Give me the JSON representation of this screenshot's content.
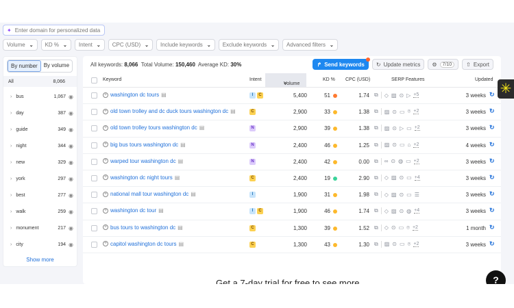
{
  "domain_input": {
    "placeholder": "Enter domain for personalized data"
  },
  "filters": [
    "Volume",
    "KD %",
    "Intent",
    "CPC (USD)",
    "Include keywords",
    "Exclude keywords",
    "Advanced filters"
  ],
  "sidebar": {
    "toggle": [
      "By number",
      "By volume"
    ],
    "all_label": "All",
    "all_count": "8,066",
    "items": [
      {
        "label": "bus",
        "count": "1,067"
      },
      {
        "label": "day",
        "count": "387"
      },
      {
        "label": "guide",
        "count": "349"
      },
      {
        "label": "night",
        "count": "344"
      },
      {
        "label": "new",
        "count": "329"
      },
      {
        "label": "york",
        "count": "297"
      },
      {
        "label": "best",
        "count": "277"
      },
      {
        "label": "walk",
        "count": "259"
      },
      {
        "label": "monument",
        "count": "217"
      },
      {
        "label": "city",
        "count": "194"
      }
    ],
    "show_more": "Show more"
  },
  "summary": {
    "all_label": "All keywords:",
    "all_value": "8,066",
    "vol_label": "Total Volume:",
    "vol_value": "150,460",
    "kd_label": "Average KD:",
    "kd_value": "30%"
  },
  "toolbar": {
    "send": "Send keywords",
    "update": "Update metrics",
    "settings_count": "7/10",
    "export": "Export"
  },
  "columns": {
    "keyword": "Keyword",
    "intent": "Intent",
    "volume": "Volume",
    "kd": "KD %",
    "cpc": "CPC (USD)",
    "serp": "SERP Features",
    "updated": "Updated"
  },
  "colors": {
    "kd_hard": "#ff7a30",
    "kd_possible": "#fdb92c",
    "kd_easy": "#3ad39a",
    "accent": "#1e88f0"
  },
  "rows": [
    {
      "keyword": "washington dc tours",
      "intent": [
        "I",
        "C"
      ],
      "volume": "5,400",
      "kd": "51",
      "kd_color": "#ff7a30",
      "cpc": "1.74",
      "serp": [
        "diamond",
        "image",
        "target",
        "play"
      ],
      "more": "+5",
      "updated": "3 weeks"
    },
    {
      "keyword": "old town trolley and dc duck tours washington dc",
      "intent": [
        "C"
      ],
      "volume": "2,900",
      "kd": "33",
      "kd_color": "#fdb92c",
      "cpc": "1.38",
      "serp": [
        "image",
        "target",
        "comment",
        "pin"
      ],
      "more": "+2",
      "updated": "3 weeks"
    },
    {
      "keyword": "old town trolley tours washington dc",
      "intent": [
        "N"
      ],
      "volume": "2,900",
      "kd": "39",
      "kd_color": "#fdb92c",
      "cpc": "1.38",
      "serp": [
        "image",
        "target",
        "play",
        "comment"
      ],
      "more": "+2",
      "updated": "3 weeks"
    },
    {
      "keyword": "big bus tours washington dc",
      "intent": [
        "N"
      ],
      "volume": "2,400",
      "kd": "46",
      "kd_color": "#fdb92c",
      "cpc": "1.25",
      "serp": [
        "image",
        "target",
        "comment",
        "cap"
      ],
      "more": "+2",
      "updated": "4 weeks"
    },
    {
      "keyword": "warped tour washington dc",
      "intent": [
        "N"
      ],
      "volume": "2,400",
      "kd": "42",
      "kd_color": "#fdb92c",
      "cpc": "0.00",
      "serp": [
        "link",
        "target",
        "globe",
        "comment"
      ],
      "more": "+2",
      "updated": "3 weeks"
    },
    {
      "keyword": "washington dc night tours",
      "intent": [
        "C"
      ],
      "volume": "2,400",
      "kd": "19",
      "kd_color": "#3ad39a",
      "cpc": "2.90",
      "serp": [
        "diamond",
        "image",
        "target",
        "comment"
      ],
      "more": "+4",
      "updated": "3 weeks"
    },
    {
      "keyword": "national mall tour washington dc",
      "intent": [
        "I"
      ],
      "volume": "1,900",
      "kd": "31",
      "kd_color": "#fdb92c",
      "cpc": "1.98",
      "serp": [
        "diamond",
        "image",
        "target",
        "comment",
        "list"
      ],
      "more": "",
      "updated": "3 weeks"
    },
    {
      "keyword": "washington dc tour",
      "intent": [
        "I",
        "C"
      ],
      "volume": "1,900",
      "kd": "46",
      "kd_color": "#fdb92c",
      "cpc": "1.74",
      "serp": [
        "diamond",
        "image",
        "target",
        "globe"
      ],
      "more": "+4",
      "updated": "3 weeks"
    },
    {
      "keyword": "bus tours to washington dc",
      "intent": [
        "C"
      ],
      "volume": "1,300",
      "kd": "39",
      "kd_color": "#fdb92c",
      "cpc": "1.52",
      "serp": [
        "diamond",
        "target",
        "comment",
        "pin"
      ],
      "more": "+2",
      "updated": "1 month"
    },
    {
      "keyword": "capitol washington dc tours",
      "intent": [
        "C"
      ],
      "volume": "1,300",
      "kd": "43",
      "kd_color": "#fdb92c",
      "cpc": "1.30",
      "serp": [
        "image",
        "target",
        "comment",
        "pin"
      ],
      "more": "+2",
      "updated": "3 weeks"
    }
  ],
  "trial_text": "Get a 7-day trial for free to see more",
  "help": "?"
}
